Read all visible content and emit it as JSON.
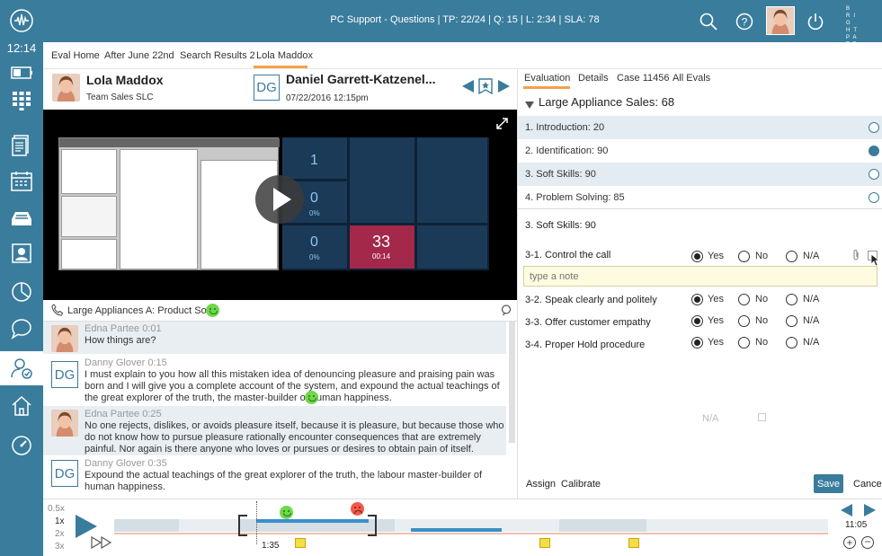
{
  "sidebar": {
    "time": "12:14"
  },
  "topbar": {
    "status": "PC Support - Questions | TP: 22/24 | Q: 15 | L: 2:34 | SLA: 78",
    "logo": "BRIGHTPATTERN"
  },
  "breadcrumbs": [
    "Eval Home",
    "After June 22nd",
    "Search Results 2",
    "Lola Maddox"
  ],
  "agent": {
    "name": "Lola Maddox",
    "team": "Team Sales SLC"
  },
  "customer": {
    "initials": "DG",
    "name": "Daniel Garrett-Katzenel...",
    "datetime": "07/22/2016 12:15pm"
  },
  "call": {
    "label": "Large Appliances A: Product Sold"
  },
  "dashboard_tiles": [
    {
      "value": "1",
      "sub": ""
    },
    {
      "value": "0",
      "sub": "0%"
    },
    {
      "value": "0",
      "sub": "0%"
    },
    {
      "value": "33",
      "sub": "00:14"
    }
  ],
  "transcript": [
    {
      "speaker": "Edna Partee",
      "time": "0:01",
      "initials": "",
      "text": "How things are?"
    },
    {
      "speaker": "Danny Glover",
      "time": "0:15",
      "initials": "DG",
      "text": "I must explain to you how all this mistaken idea of denouncing pleasure and praising pain was born and I will give you a complete account of the system, and expound the actual teachings of the great explorer of the truth, the master-builder of human happiness."
    },
    {
      "speaker": "Edna Partee",
      "time": "0:25",
      "initials": "",
      "text": "No one rejects, dislikes, or avoids pleasure itself, because it is pleasure, but because those who do not know how to pursue pleasure rationally encounter consequences that are extremely painful. Nor again is there anyone who loves or pursues or desires to obtain pain of itself."
    },
    {
      "speaker": "Danny Glover",
      "time": "0:35",
      "initials": "DG",
      "text": "Expound the actual teachings of the great explorer of the truth, the labour master-builder of human happiness."
    }
  ],
  "tabs": [
    "Evaluation",
    "Details",
    "Case 11456",
    "All Evals"
  ],
  "evaluation": {
    "title": "Large Appliance Sales: 68",
    "sections": [
      {
        "label": "1. Introduction: 20",
        "selected": false
      },
      {
        "label": "2. Identification: 90",
        "selected": true
      },
      {
        "label": "3. Soft Skills: 90",
        "selected": false
      },
      {
        "label": "4. Problem Solving: 85",
        "selected": false
      }
    ],
    "current_section": "3. Soft Skills: 90",
    "questions": [
      {
        "label": "3-1. Control the call",
        "answer": "Yes"
      },
      {
        "label": "3-2. Speak clearly and politely",
        "answer": "Yes"
      },
      {
        "label": "3-3. Offer customer empathy",
        "answer": "Yes"
      },
      {
        "label": "3-4. Proper Hold procedure",
        "answer": "Yes"
      }
    ],
    "options": [
      "Yes",
      "No",
      "N/A"
    ],
    "note_placeholder": "type a note",
    "na_label": "N/A",
    "assign": "Assign",
    "calibrate": "Calibrate",
    "save": "Save",
    "cancel": "Cancel"
  },
  "player": {
    "speeds": [
      "0.5x",
      "1x",
      "2x",
      "3x"
    ],
    "current_speed": "1x",
    "position": "1:35",
    "duration": "11:05",
    "progress": 0.19
  },
  "colors": {
    "brand": "#3a7c9c",
    "save": "#3a7c9c",
    "tile_alert": "#a3284a",
    "smile": "#6ed84a",
    "frown": "#f05a4a"
  }
}
